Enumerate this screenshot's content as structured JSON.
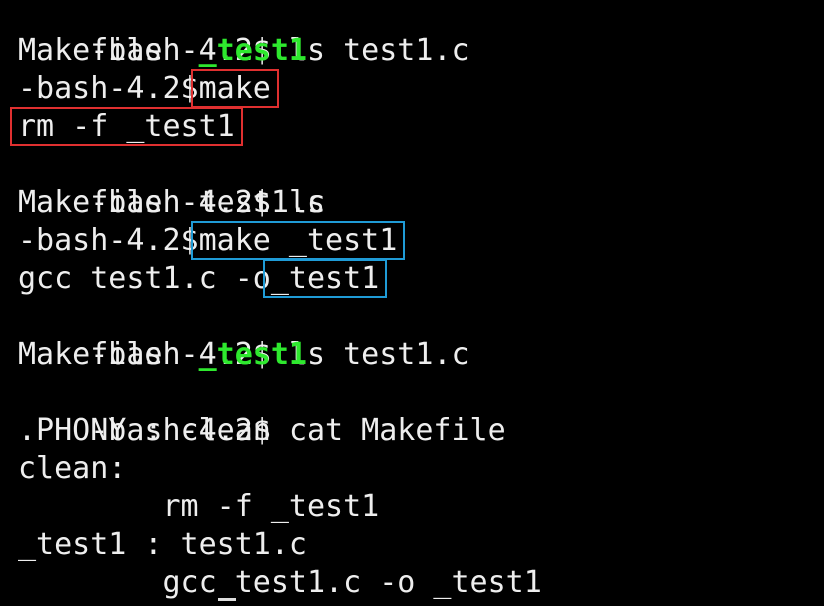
{
  "terminal": {
    "lines": [
      {
        "prompt": "-bash-4.2$",
        "cmd": "ls"
      },
      {
        "out": [
          "Makefile",
          "_test1",
          "test1.c"
        ]
      },
      {
        "prompt": "-bash-4.2$",
        "cmd": "make"
      },
      {
        "out_single": "rm -f _test1"
      },
      {
        "prompt": "-bash-4.2$",
        "cmd": "ls"
      },
      {
        "out": [
          "Makefile",
          "test1.c"
        ]
      },
      {
        "prompt": "-bash-4.2$",
        "cmd": "make _test1"
      },
      {
        "gcc_prefix": "gcc test1.c -o",
        "gcc_target": "_test1"
      },
      {
        "prompt": "-bash-4.2$",
        "cmd": "ls"
      },
      {
        "out": [
          "Makefile",
          "_test1",
          "test1.c"
        ]
      },
      {
        "prompt": "-bash-4.2$",
        "cmd": "cat Makefile"
      },
      {
        "text": ".PHONY : clean"
      },
      {
        "text": "clean:"
      },
      {
        "text": "        rm -f _test1"
      },
      {
        "text": "_test1 : test1.c"
      },
      {
        "text": "        gcc test1.c -o _test1"
      }
    ]
  },
  "colors": {
    "background": "#000000",
    "foreground": "#eeeeee",
    "executable": "#2ee82e",
    "highlight_red": "#e03030",
    "highlight_blue": "#1f9bd6"
  }
}
